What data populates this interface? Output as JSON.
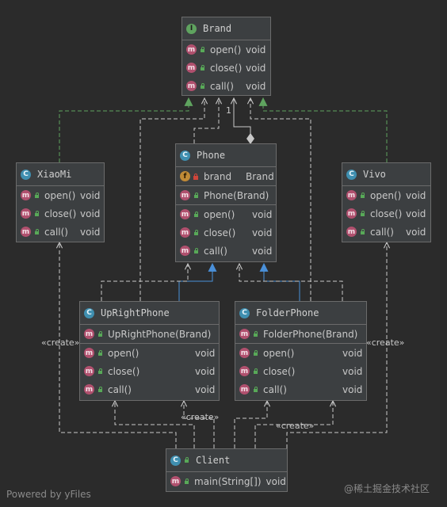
{
  "classes": {
    "brand": {
      "name": "Brand",
      "kind_icon": "I",
      "methods": [
        {
          "sig": "open()",
          "ret": "void"
        },
        {
          "sig": "close()",
          "ret": "void"
        },
        {
          "sig": "call()",
          "ret": "void"
        }
      ]
    },
    "phone": {
      "name": "Phone",
      "kind_icon": "C",
      "fields": [
        {
          "name": "brand",
          "type": "Brand"
        }
      ],
      "constructors": [
        {
          "sig": "Phone(Brand)"
        }
      ],
      "methods": [
        {
          "sig": "open()",
          "ret": "void"
        },
        {
          "sig": "close()",
          "ret": "void"
        },
        {
          "sig": "call()",
          "ret": "void"
        }
      ]
    },
    "xiaomi": {
      "name": "XiaoMi",
      "kind_icon": "C",
      "methods": [
        {
          "sig": "open()",
          "ret": "void"
        },
        {
          "sig": "close()",
          "ret": "void"
        },
        {
          "sig": "call()",
          "ret": "void"
        }
      ]
    },
    "vivo": {
      "name": "Vivo",
      "kind_icon": "C",
      "methods": [
        {
          "sig": "open()",
          "ret": "void"
        },
        {
          "sig": "close()",
          "ret": "void"
        },
        {
          "sig": "call()",
          "ret": "void"
        }
      ]
    },
    "uprightphone": {
      "name": "UpRightPhone",
      "kind_icon": "C",
      "constructors": [
        {
          "sig": "UpRightPhone(Brand)"
        }
      ],
      "methods": [
        {
          "sig": "open()",
          "ret": "void"
        },
        {
          "sig": "close()",
          "ret": "void"
        },
        {
          "sig": "call()",
          "ret": "void"
        }
      ]
    },
    "folderphone": {
      "name": "FolderPhone",
      "kind_icon": "C",
      "constructors": [
        {
          "sig": "FolderPhone(Brand)"
        }
      ],
      "methods": [
        {
          "sig": "open()",
          "ret": "void"
        },
        {
          "sig": "close()",
          "ret": "void"
        },
        {
          "sig": "call()",
          "ret": "void"
        }
      ]
    },
    "client": {
      "name": "Client",
      "kind_icon": "C",
      "methods": [
        {
          "sig": "main(String[])",
          "ret": "void"
        }
      ]
    }
  },
  "member_icon": "m",
  "field_icon": "f",
  "labels": {
    "create": "«create»",
    "multiplicity": "1"
  },
  "colors": {
    "background": "#2b2b2b",
    "box": "#3c3f41",
    "border": "#6b6b6b",
    "dependency_line": "#c8c8c8",
    "realization_arrow": "#5fa35f",
    "inheritance_arrow": "#4a90d9"
  },
  "watermarks": {
    "left": "Powered by yFiles",
    "right": "@稀土掘金技术社区"
  }
}
